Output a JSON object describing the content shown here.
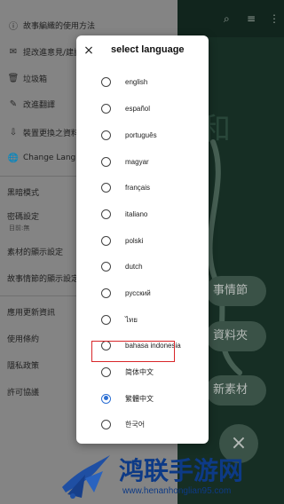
{
  "background_app": {
    "big_char": "和",
    "pills": [
      "事情節",
      "資料夾",
      "新素材"
    ],
    "fab_symbol": "×",
    "topbar_icons": [
      "search-icon",
      "sort-icon",
      "more-icon"
    ]
  },
  "drawer": {
    "items": [
      {
        "icon": "info-icon",
        "glyph": "ⓘ",
        "label": "故事編織的使用方法"
      },
      {
        "icon": "mail-icon",
        "glyph": "✉",
        "label": "提改進意見/建議"
      },
      {
        "icon": "trash-icon",
        "glyph": "🗑",
        "label": "垃圾箱"
      },
      {
        "icon": "pencil-icon",
        "glyph": "✎",
        "label": "改進翻譯"
      },
      {
        "icon": "device-icon",
        "glyph": "⇩",
        "label": "裝置更換之資料遷"
      },
      {
        "icon": "globe-icon",
        "glyph": "🌐",
        "label": "Change Language"
      },
      {
        "icon": "",
        "glyph": "",
        "label": "黑暗模式"
      },
      {
        "icon": "",
        "glyph": "",
        "label": "密碼設定"
      },
      {
        "icon": "",
        "glyph": "",
        "label": "素材的顯示設定"
      },
      {
        "icon": "",
        "glyph": "",
        "label": "故事情節的顯示設定"
      },
      {
        "icon": "",
        "glyph": "",
        "label": "應用更新資訊"
      },
      {
        "icon": "",
        "glyph": "",
        "label": "使用條約"
      },
      {
        "icon": "",
        "glyph": "",
        "label": "隱私政策"
      },
      {
        "icon": "",
        "glyph": "",
        "label": "許可協議"
      }
    ],
    "password_sub": "目前:無"
  },
  "dialog": {
    "title": "select language",
    "close_symbol": "×",
    "languages": [
      {
        "label": "english",
        "checked": false
      },
      {
        "label": "español",
        "checked": false
      },
      {
        "label": "português",
        "checked": false
      },
      {
        "label": "magyar",
        "checked": false
      },
      {
        "label": "français",
        "checked": false
      },
      {
        "label": "italiano",
        "checked": false
      },
      {
        "label": "polski",
        "checked": false
      },
      {
        "label": "dutch",
        "checked": false
      },
      {
        "label": "русский",
        "checked": false
      },
      {
        "label": "ไทย",
        "checked": false
      },
      {
        "label": "bahasa indonesia",
        "checked": false
      },
      {
        "label": "简体中文",
        "checked": false
      },
      {
        "label": "繁體中文",
        "checked": true
      },
      {
        "label": "한국어",
        "checked": false
      }
    ],
    "highlighted_language": "简体中文"
  },
  "watermark": {
    "title": "鸿联手游网",
    "url": "www.henanhonglian95.com"
  },
  "colors": {
    "accent": "#2c6fd3",
    "highlight_box": "#d8262a",
    "watermark": "#0d3a86",
    "drawer_bg": "#a9a9a9",
    "app_bg": "#1d3b2f"
  }
}
